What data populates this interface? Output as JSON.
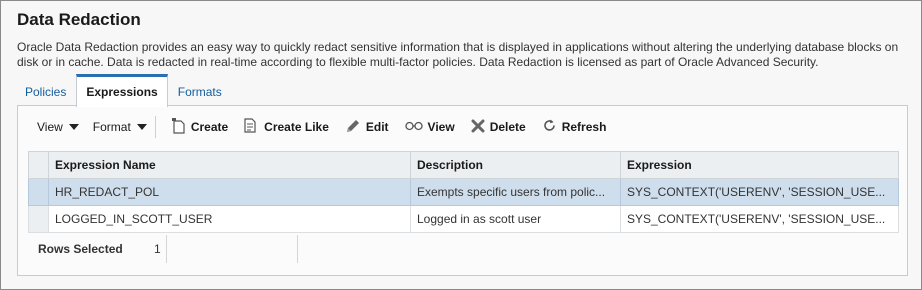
{
  "page": {
    "title": "Data Redaction",
    "description": "Oracle Data Redaction provides an easy way to quickly redact sensitive information that is displayed in applications without altering the underlying database blocks on disk or in cache. Data is redacted in real-time according to flexible multi-factor policies. Data Redaction is licensed as part of Oracle Advanced Security."
  },
  "tabs": [
    {
      "label": "Policies",
      "active": false
    },
    {
      "label": "Expressions",
      "active": true
    },
    {
      "label": "Formats",
      "active": false
    }
  ],
  "toolbar": {
    "view_label": "View",
    "format_label": "Format",
    "create_label": "Create",
    "create_like_label": "Create Like",
    "edit_label": "Edit",
    "view_button_label": "View",
    "delete_label": "Delete",
    "refresh_label": "Refresh"
  },
  "table": {
    "columns": [
      "Expression Name",
      "Description",
      "Expression"
    ],
    "rows": [
      {
        "name": "HR_REDACT_POL",
        "description": "Exempts specific users from polic...",
        "expression": "SYS_CONTEXT('USERENV', 'SESSION_USE...",
        "selected": true
      },
      {
        "name": "LOGGED_IN_SCOTT_USER",
        "description": "Logged in as scott user",
        "expression": "SYS_CONTEXT('USERENV', 'SESSION_USE...",
        "selected": false
      }
    ]
  },
  "footer": {
    "rows_selected_label": "Rows Selected",
    "rows_selected_value": "1"
  },
  "colors": {
    "accent": "#2a6fb0",
    "selected_row": "#cfdeec",
    "link": "#145c9e"
  }
}
